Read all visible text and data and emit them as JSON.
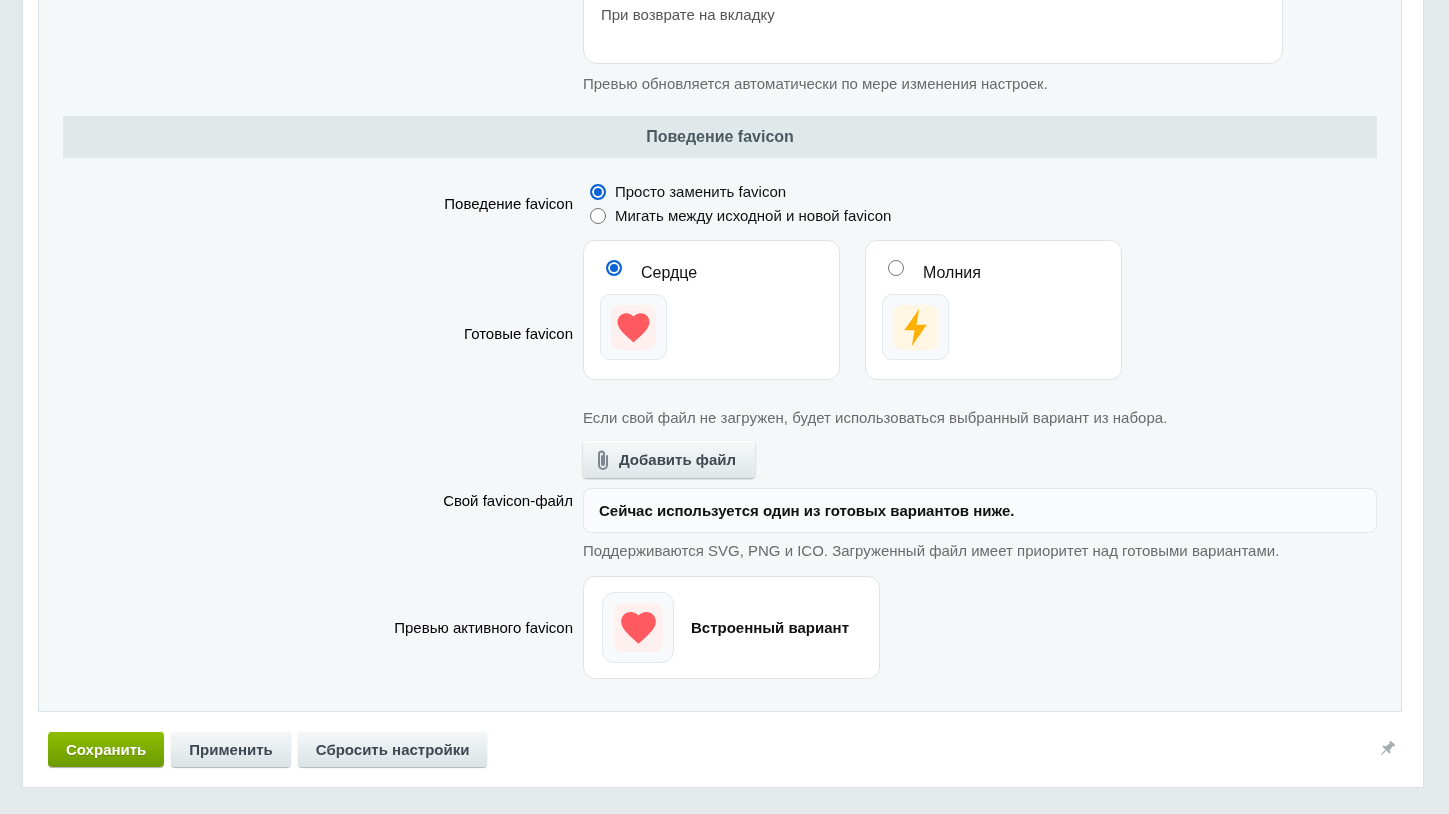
{
  "preview_box": {
    "text": "При возврате на вкладку"
  },
  "preview_hint": "Превью обновляется автоматически по мере изменения настроек.",
  "section": {
    "title": "Поведение favicon"
  },
  "fields": [
    {
      "kind": "radio_group",
      "label": "Поведение favicon",
      "options": [
        {
          "label": "Просто заменить favicon",
          "selected": true
        },
        {
          "label": "Мигать между исходной и новой favicon",
          "selected": false
        }
      ]
    },
    {
      "kind": "preset_cards",
      "label": "Готовые favicon",
      "options": [
        {
          "label": "Сердце",
          "selected": true,
          "kind": "heart"
        },
        {
          "label": "Молния",
          "selected": false,
          "kind": "bolt"
        }
      ],
      "hint": "Если свой файл не загружен, будет использоваться выбранный вариант из набора."
    },
    {
      "kind": "file_upload",
      "label": "Свой favicon-файл",
      "button": "Добавить файл",
      "status": "Сейчас используется один из готовых вариантов ниже.",
      "hint": "Поддерживаются SVG, PNG и ICO. Загруженный файл имеет приоритет над готовыми вариантами."
    },
    {
      "kind": "active_preview",
      "label": "Превью активного favicon",
      "caption": "Встроенный вариант"
    }
  ],
  "buttons": [
    {
      "label": "Сохранить",
      "kind": "primary"
    },
    {
      "label": "Применить",
      "kind": "default"
    },
    {
      "label": "Сбросить настройки",
      "kind": "default"
    }
  ]
}
